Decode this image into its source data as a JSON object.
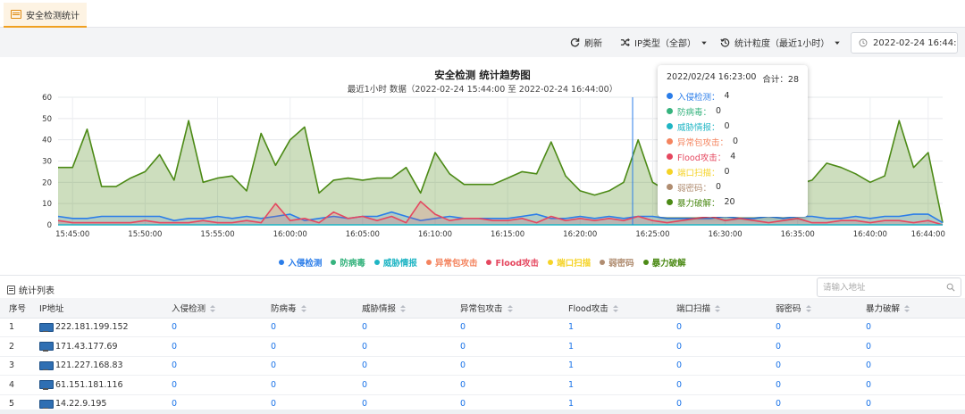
{
  "tab": {
    "label": "安全检测统计"
  },
  "toolbar": {
    "refresh": "刷新",
    "ip_type": "IP类型（全部）",
    "granularity": "统计粒度（最近1小时）",
    "datetime": "2022-02-24 16:44:51"
  },
  "colors": {
    "intrusion": "#2b7de9",
    "antivirus": "#36b37e",
    "threat": "#1fb5c4",
    "abnormal": "#f4845f",
    "flood": "#e5475f",
    "portscan": "#f5d327",
    "weakpwd": "#b08d71",
    "bruteforce": "#4c8a16"
  },
  "chart_data": {
    "type": "area",
    "title": "安全检测 统计趋势图",
    "subtitle": "最近1小时 数据（2022-02-24 15:44:00 至 2022-02-24 16:44:00）",
    "ylim": [
      0,
      60
    ],
    "yticks": [
      0,
      10,
      20,
      30,
      40,
      50,
      60
    ],
    "xticks": [
      "15:45:00",
      "15:50:00",
      "15:55:00",
      "16:00:00",
      "16:05:00",
      "16:10:00",
      "16:15:00",
      "16:20:00",
      "16:25:00",
      "16:30:00",
      "16:35:00",
      "16:40:00",
      "16:44:00"
    ],
    "legend": [
      "入侵检测",
      "防病毒",
      "威胁情报",
      "异常包攻击",
      "Flood攻击",
      "端口扫描",
      "弱密码",
      "暴力破解"
    ],
    "series": [
      {
        "name": "暴力破解",
        "key": "bruteforce",
        "values": [
          27,
          27,
          45,
          18,
          18,
          22,
          25,
          33,
          21,
          49,
          20,
          22,
          23,
          16,
          43,
          28,
          40,
          46,
          15,
          21,
          22,
          21,
          22,
          22,
          27,
          15,
          34,
          24,
          19,
          19,
          19,
          22,
          25,
          24,
          39,
          23,
          16,
          14,
          16,
          20,
          40,
          20,
          16,
          28,
          27,
          20,
          18,
          14,
          18,
          27,
          22,
          19,
          21,
          29,
          27,
          24,
          20,
          23,
          49,
          27,
          34,
          1
        ]
      },
      {
        "name": "入侵检测",
        "key": "intrusion",
        "values": [
          4,
          3,
          3,
          4,
          4,
          4,
          4,
          4,
          2,
          3,
          3,
          4,
          3,
          4,
          3,
          4,
          5,
          2,
          3,
          4,
          3,
          4,
          4,
          6,
          4,
          2,
          3,
          4,
          3,
          3,
          3,
          3,
          4,
          5,
          3,
          3,
          4,
          3,
          4,
          3,
          4,
          4,
          3,
          3,
          3,
          3,
          4,
          3,
          3,
          4,
          3,
          4,
          4,
          3,
          3,
          4,
          3,
          4,
          4,
          5,
          5,
          1
        ]
      },
      {
        "name": "Flood攻击",
        "key": "flood",
        "values": [
          2,
          1,
          1,
          1,
          1,
          1,
          2,
          1,
          1,
          1,
          2,
          1,
          1,
          2,
          1,
          10,
          2,
          3,
          1,
          6,
          3,
          4,
          2,
          4,
          1,
          11,
          5,
          2,
          3,
          3,
          2,
          2,
          3,
          1,
          4,
          2,
          3,
          2,
          3,
          2,
          4,
          2,
          1,
          2,
          3,
          4,
          2,
          3,
          2,
          1,
          2,
          3,
          1,
          1,
          2,
          2,
          1,
          2,
          2,
          1,
          2,
          0
        ]
      },
      {
        "name": "威胁情报",
        "key": "threat",
        "values": [
          0,
          0,
          0,
          0,
          0,
          0,
          0,
          0,
          0,
          0,
          0,
          0,
          0,
          0,
          0,
          0,
          0,
          0,
          0,
          0,
          0,
          0,
          0,
          0,
          0,
          0,
          0,
          0,
          0,
          0,
          0,
          0,
          0,
          0,
          0,
          0,
          0,
          0,
          0,
          0,
          0,
          0,
          0,
          0,
          0,
          0,
          0,
          0,
          0,
          0,
          0,
          0,
          0,
          0,
          0,
          0,
          0,
          0,
          0,
          0,
          0,
          0
        ]
      }
    ]
  },
  "tooltip": {
    "time": "2022/02/24 16:23:00",
    "total_label": "合计：28",
    "items": [
      {
        "label": "入侵检测：",
        "value": "4",
        "key": "intrusion"
      },
      {
        "label": "防病毒：",
        "value": "0",
        "key": "antivirus"
      },
      {
        "label": "威胁情报：",
        "value": "0",
        "key": "threat"
      },
      {
        "label": "异常包攻击：",
        "value": "0",
        "key": "abnormal"
      },
      {
        "label": "Flood攻击：",
        "value": "4",
        "key": "flood"
      },
      {
        "label": "端口扫描：",
        "value": "0",
        "key": "portscan"
      },
      {
        "label": "弱密码：",
        "value": "0",
        "key": "weakpwd"
      },
      {
        "label": "暴力破解：",
        "value": "20",
        "key": "bruteforce"
      }
    ]
  },
  "list": {
    "title": "统计列表",
    "search_placeholder": "请输入地址",
    "headers": [
      "序号",
      "IP地址",
      "入侵检测",
      "防病毒",
      "威胁情报",
      "异常包攻击",
      "Flood攻击",
      "端口扫描",
      "弱密码",
      "暴力破解"
    ],
    "rows": [
      [
        "1",
        "222.181.199.152",
        "0",
        "0",
        "0",
        "0",
        "1",
        "0",
        "0",
        "0"
      ],
      [
        "2",
        "171.43.177.69",
        "0",
        "0",
        "0",
        "0",
        "1",
        "0",
        "0",
        "0"
      ],
      [
        "3",
        "121.227.168.83",
        "0",
        "0",
        "0",
        "0",
        "1",
        "0",
        "0",
        "0"
      ],
      [
        "4",
        "61.151.181.116",
        "0",
        "0",
        "0",
        "0",
        "1",
        "0",
        "0",
        "0"
      ],
      [
        "5",
        "14.22.9.195",
        "0",
        "0",
        "0",
        "0",
        "1",
        "0",
        "0",
        "0"
      ]
    ]
  }
}
